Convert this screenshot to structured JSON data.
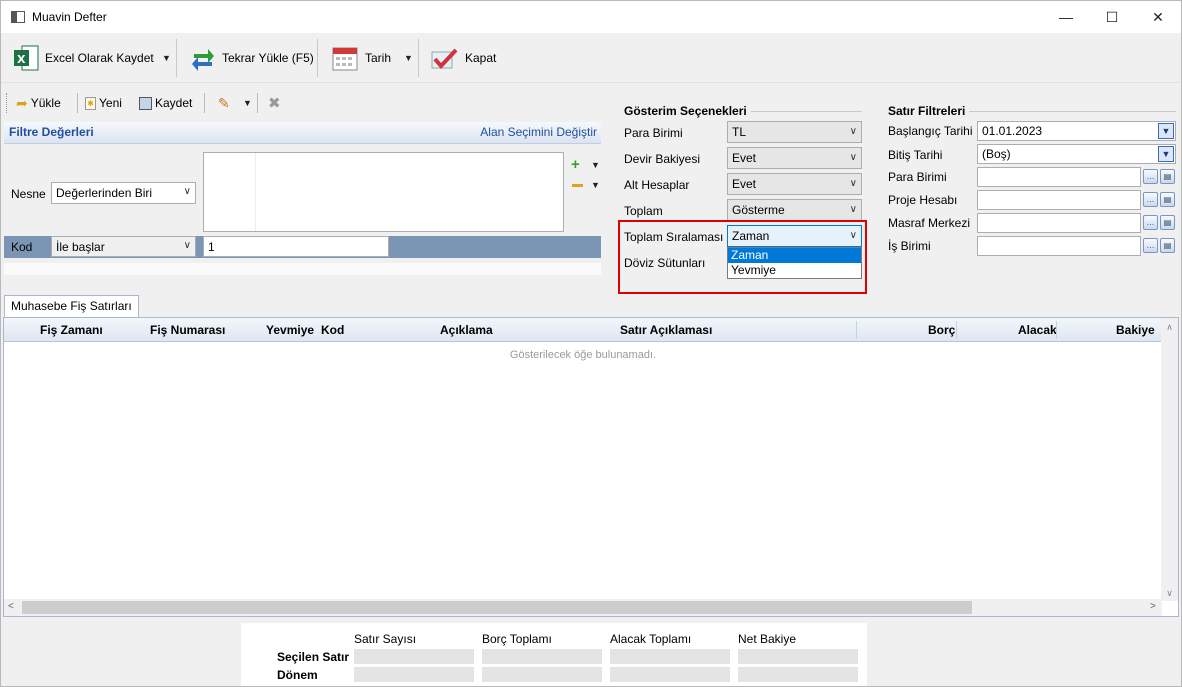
{
  "window": {
    "title": "Muavin Defter"
  },
  "toolbar1": {
    "excel": "Excel Olarak Kaydet",
    "reload": "Tekrar Yükle (F5)",
    "date": "Tarih",
    "close": "Kapat"
  },
  "toolbar2": {
    "load": "Yükle",
    "new": "Yeni",
    "save": "Kaydet"
  },
  "filter": {
    "header": "Filtre Değerleri",
    "change_fields": "Alan Seçimini Değiştir",
    "nesne_label": "Nesne",
    "nesne_value": "Değerlerinden Biri",
    "kod_label": "Kod",
    "kod_op": "İle başlar",
    "kod_value": "1"
  },
  "display": {
    "title": "Gösterim Seçenekleri",
    "rows": [
      {
        "label": "Para Birimi",
        "value": "TL"
      },
      {
        "label": "Devir Bakiyesi",
        "value": "Evet"
      },
      {
        "label": "Alt Hesaplar",
        "value": "Evet"
      },
      {
        "label": "Toplam",
        "value": "Gösterme"
      },
      {
        "label": "Toplam Sıralaması",
        "value": "Zaman"
      },
      {
        "label": "Döviz Sütunları",
        "value": ""
      }
    ],
    "dropdown_options": [
      "Zaman",
      "Yevmiye"
    ],
    "dropdown_selected": "Zaman"
  },
  "row_filters": {
    "title": "Satır Filtreleri",
    "rows": [
      {
        "label": "Başlangıç Tarihi",
        "value": "01.01.2023"
      },
      {
        "label": "Bitiş Tarihi",
        "value": "(Boş)"
      },
      {
        "label": "Para Birimi",
        "value": ""
      },
      {
        "label": "Proje Hesabı",
        "value": ""
      },
      {
        "label": "Masraf Merkezi",
        "value": ""
      },
      {
        "label": "İş Birimi",
        "value": ""
      }
    ]
  },
  "grid": {
    "tab": "Muhasebe Fiş Satırları",
    "columns": [
      "Fiş Zamanı",
      "Fiş Numarası",
      "Yevmiye",
      "Kod",
      "Açıklama",
      "Satır Açıklaması",
      "Borç",
      "Alacak",
      "Bakiye"
    ],
    "empty_message": "Gösterilecek öğe bulunamadı."
  },
  "summary": {
    "headers": [
      "Satır Sayısı",
      "Borç Toplamı",
      "Alacak Toplamı",
      "Net Bakiye"
    ],
    "rows": [
      "Seçilen Satır",
      "Dönem"
    ]
  },
  "colors": {
    "accent": "#0078d7",
    "highlight_box": "#e00000",
    "header_blue": "#1f4e9c"
  }
}
